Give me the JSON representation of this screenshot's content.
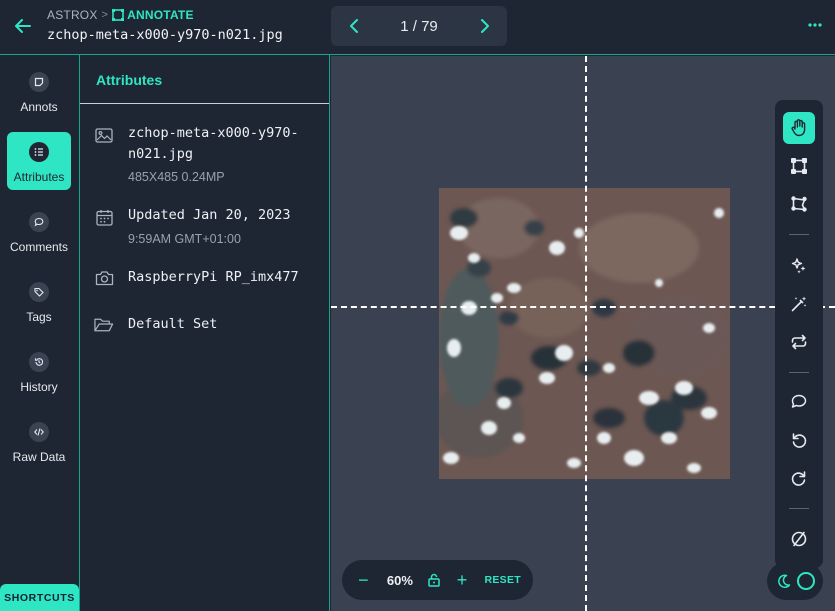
{
  "header": {
    "app_name": "ASTROX",
    "breadcrumb_separator": ">",
    "current_mode": "ANNOTATE",
    "filename": "zchop-meta-x000-y970-n021.jpg",
    "pager_text": "1 / 79"
  },
  "nav": {
    "items": [
      {
        "label": "Annots",
        "icon": "note-icon"
      },
      {
        "label": "Attributes",
        "icon": "list-icon",
        "active": true
      },
      {
        "label": "Comments",
        "icon": "comment-icon"
      },
      {
        "label": "Tags",
        "icon": "tag-icon"
      },
      {
        "label": "History",
        "icon": "history-icon"
      },
      {
        "label": "Raw Data",
        "icon": "code-icon"
      }
    ],
    "shortcuts_label": "SHORTCUTS"
  },
  "attributes": {
    "title": "Attributes",
    "file_name": "zchop-meta-x000-y970-n021.jpg",
    "file_dims": "485X485  0.24MP",
    "updated": "Updated Jan 20, 2023",
    "updated_time": "9:59AM  GMT+01:00",
    "camera": "RaspberryPi RP_imx477",
    "set": "Default Set"
  },
  "zoom": {
    "minus": "−",
    "level": "60%",
    "plus": "+",
    "reset": "RESET"
  },
  "colors": {
    "accent": "#2ee6c4",
    "background": "#1e2633",
    "canvas": "#3a4150"
  }
}
